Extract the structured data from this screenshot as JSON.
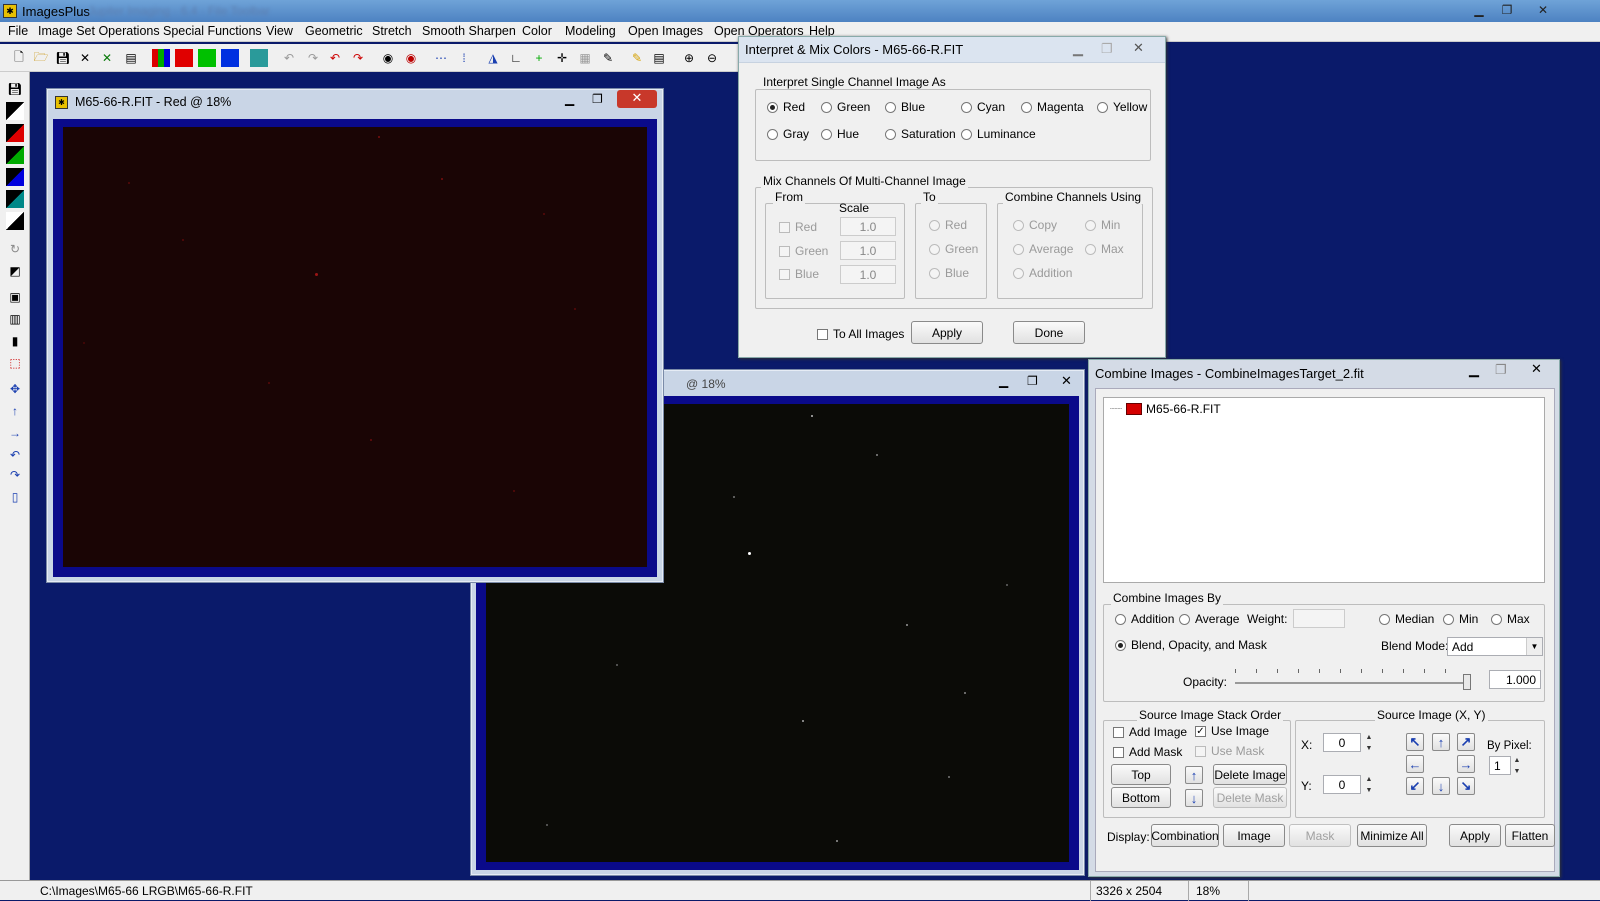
{
  "app": {
    "title": "ImagesPlus",
    "title_blur": "Jupiter Imaging  · 6.4 · File Toolbar",
    "window_controls": [
      "minimize-icon",
      "maximize-icon",
      "close-icon"
    ]
  },
  "menu": [
    "File",
    "Image Set Operations",
    "Special Functions",
    "View",
    "Geometric",
    "Stretch",
    "Smooth Sharpen",
    "Color",
    "Modeling",
    "Open Images",
    "Open Operators",
    "Help"
  ],
  "image_window_red": {
    "title": "M65-66-R.FIT - Red @ 18%"
  },
  "image_window_2": {
    "title_partial": "@ 18%"
  },
  "interpret_dialog": {
    "title": "Interpret & Mix Colors - M65-66-R.FIT",
    "group1_label": "Interpret Single Channel Image As",
    "options_row1": [
      "Red",
      "Green",
      "Blue",
      "Cyan",
      "Magenta",
      "Yellow"
    ],
    "options_row2": [
      "Gray",
      "Hue",
      "Saturation",
      "Luminance"
    ],
    "selected": "Red",
    "group2_label": "Mix Channels Of Multi-Channel Image",
    "from_label": "From",
    "scale_label": "Scale",
    "from_channels": [
      "Red",
      "Green",
      "Blue"
    ],
    "scale_values": [
      "1.0",
      "1.0",
      "1.0"
    ],
    "to_label": "To",
    "to_channels": [
      "Red",
      "Green",
      "Blue"
    ],
    "combine_label": "Combine Channels Using",
    "combine_options": [
      "Copy",
      "Min",
      "Average",
      "Max",
      "Addition"
    ],
    "to_all_images": "To All Images",
    "apply": "Apply",
    "done": "Done"
  },
  "combine_dialog": {
    "title": "Combine Images - CombineImagesTarget_2.fit",
    "tree_item": "M65-66-R.FIT",
    "tree_item_color": "#d40000",
    "combine_by_label": "Combine Images By",
    "addition": "Addition",
    "average": "Average",
    "weight_label": "Weight:",
    "weight_value": "",
    "median": "Median",
    "min": "Min",
    "max": "Max",
    "blend": "Blend, Opacity, and Mask",
    "blend_mode_label": "Blend Mode:",
    "blend_mode_value": "Add",
    "opacity_label": "Opacity:",
    "opacity_value": "1.000",
    "stack_label": "Source Image Stack Order",
    "add_image": "Add Image",
    "use_image": "Use Image",
    "add_mask": "Add Mask",
    "use_mask": "Use Mask",
    "top": "Top",
    "bottom": "Bottom",
    "delete_image": "Delete Image",
    "delete_mask": "Delete Mask",
    "source_xy_label": "Source Image (X, Y)",
    "x_label": "X:",
    "x_value": "0",
    "y_label": "Y:",
    "y_value": "0",
    "by_pixel_label": "By Pixel:",
    "by_pixel_value": "1",
    "display_label": "Display:",
    "combination": "Combination",
    "image": "Image",
    "mask": "Mask",
    "minimize_all": "Minimize All",
    "apply": "Apply",
    "flatten": "Flatten"
  },
  "status": {
    "path": "C:\\Images\\M65-66 LRGB\\M65-66-R.FIT",
    "dimensions": "3326 x 2504",
    "zoom": "18%"
  },
  "colors": {
    "desktop": "#0a1a6a",
    "image_frame": "#0a0a8a",
    "red_canvas": "#1a0505"
  }
}
